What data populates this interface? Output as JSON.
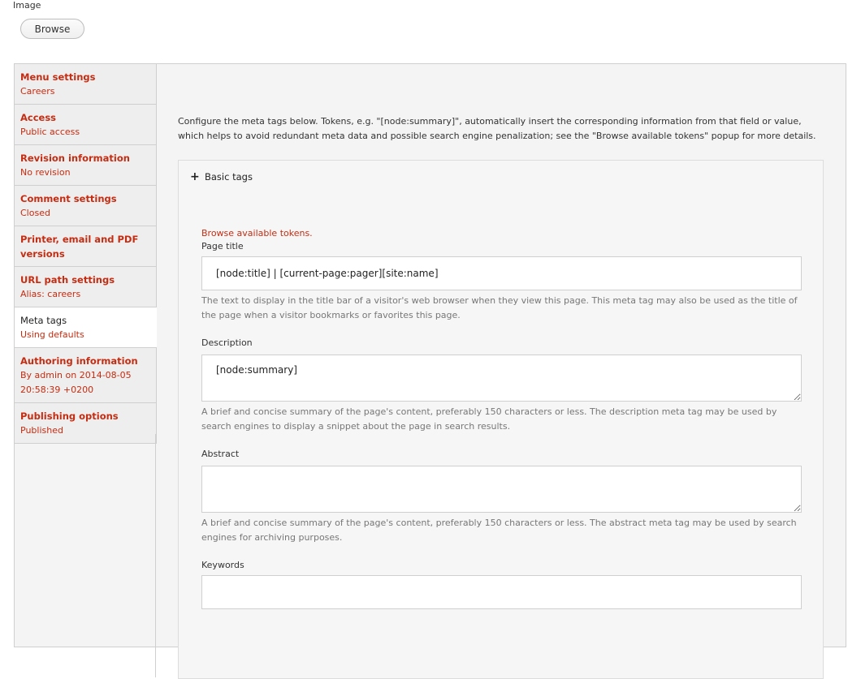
{
  "image_field": {
    "label": "Image",
    "browse_label": "Browse"
  },
  "tabs": [
    {
      "title": "Menu settings",
      "summary": "Careers"
    },
    {
      "title": "Access",
      "summary": "Public access"
    },
    {
      "title": "Revision information",
      "summary": "No revision"
    },
    {
      "title": "Comment settings",
      "summary": "Closed"
    },
    {
      "title": "Printer, email and PDF versions",
      "summary": ""
    },
    {
      "title": "URL path settings",
      "summary": "Alias: careers"
    },
    {
      "title": "Meta tags",
      "summary": "Using defaults",
      "active": true
    },
    {
      "title": "Authoring information",
      "summary": "By admin on 2014-08-05 20:58:39 +0200"
    },
    {
      "title": "Publishing options",
      "summary": "Published"
    }
  ],
  "meta": {
    "intro": "Configure the meta tags below. Tokens, e.g. \"[node:summary]\", automatically insert the corresponding information from that field or value, which helps to avoid redundant meta data and possible search engine penalization; see the \"Browse available tokens\" popup for more details.",
    "fieldset_legend": "Basic tags",
    "browse_tokens": "Browse available tokens.",
    "page_title": {
      "label": "Page title",
      "value": "[node:title] | [current-page:pager][site:name]",
      "description": "The text to display in the title bar of a visitor's web browser when they view this page. This meta tag may also be used as the title of the page when a visitor bookmarks or favorites this page."
    },
    "description": {
      "label": "Description",
      "value": "[node:summary]",
      "description": "A brief and concise summary of the page's content, preferably 150 characters or less. The description meta tag may be used by search engines to display a snippet about the page in search results."
    },
    "abstract": {
      "label": "Abstract",
      "value": "",
      "description": "A brief and concise summary of the page's content, preferably 150 characters or less. The abstract meta tag may be used by search engines for archiving purposes."
    },
    "keywords": {
      "label": "Keywords",
      "value": ""
    }
  },
  "colors": {
    "link": "#c52d12",
    "tab_bg": "#eeeeee",
    "panel_bg": "#f4f4f4"
  }
}
